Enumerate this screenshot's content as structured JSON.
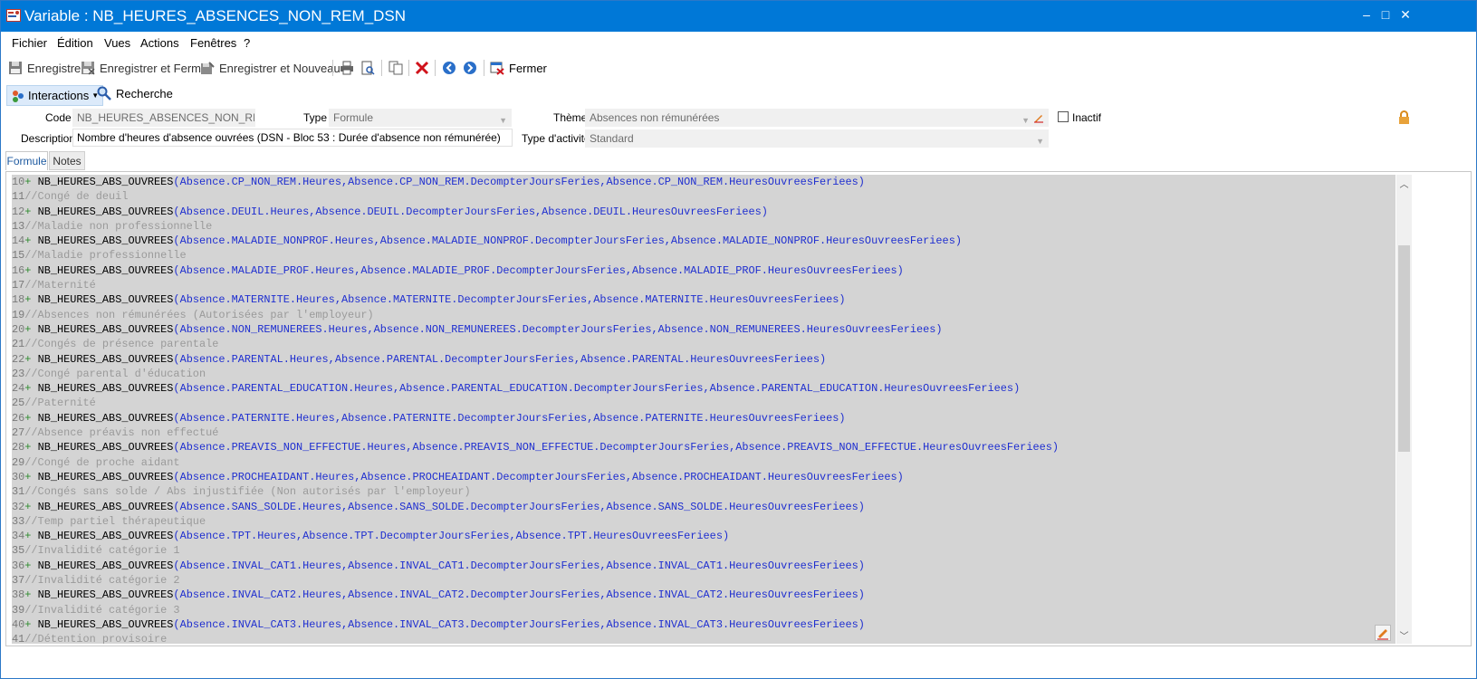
{
  "window": {
    "title": "Variable : NB_HEURES_ABSENCES_NON_REM_DSN",
    "minimize": "–",
    "maximize": "□",
    "close": "✕"
  },
  "menu": [
    "Fichier",
    "Édition",
    "Vues",
    "Actions",
    "Fenêtres",
    "?"
  ],
  "toolbar": {
    "save": "Enregistrer",
    "save_close": "Enregistrer et Fermer",
    "save_new": "Enregistrer et Nouveau",
    "close": "Fermer"
  },
  "toolbar2": {
    "interactions": "Interactions",
    "search": "Recherche"
  },
  "form": {
    "code_label": "Code",
    "code_value": "NB_HEURES_ABSENCES_NON_REM_DSN",
    "type_label": "Type",
    "type_value": "Formule",
    "theme_label": "Thème",
    "theme_value": "Absences non rémunérées",
    "inactive_label": "Inactif",
    "description_label": "Description",
    "description_value": "Nombre d'heures d'absence ouvrées (DSN - Bloc 53 : Durée d'absence non rémunérée)",
    "activity_label": "Type d'activité",
    "activity_value": "Standard"
  },
  "tabs": [
    "Formule",
    "Notes"
  ],
  "code_lines": [
    {
      "n": "10",
      "kind": "call",
      "fn": "NB_HEURES_ABS_OUVREES",
      "args": "Absence.CP_NON_REM.Heures,Absence.CP_NON_REM.DecompterJoursFeries,Absence.CP_NON_REM.HeuresOuvreesFeriees"
    },
    {
      "n": "11",
      "kind": "comment",
      "text": "//Congé de deuil"
    },
    {
      "n": "12",
      "kind": "call",
      "fn": "NB_HEURES_ABS_OUVREES",
      "args": "Absence.DEUIL.Heures,Absence.DEUIL.DecompterJoursFeries,Absence.DEUIL.HeuresOuvreesFeriees"
    },
    {
      "n": "13",
      "kind": "comment",
      "text": "//Maladie non professionnelle"
    },
    {
      "n": "14",
      "kind": "call",
      "fn": "NB_HEURES_ABS_OUVREES",
      "args": "Absence.MALADIE_NONPROF.Heures,Absence.MALADIE_NONPROF.DecompterJoursFeries,Absence.MALADIE_NONPROF.HeuresOuvreesFeriees"
    },
    {
      "n": "15",
      "kind": "comment",
      "text": "//Maladie professionnelle"
    },
    {
      "n": "16",
      "kind": "call",
      "fn": "NB_HEURES_ABS_OUVREES",
      "args": "Absence.MALADIE_PROF.Heures,Absence.MALADIE_PROF.DecompterJoursFeries,Absence.MALADIE_PROF.HeuresOuvreesFeriees"
    },
    {
      "n": "17",
      "kind": "comment",
      "text": "//Maternité"
    },
    {
      "n": "18",
      "kind": "call",
      "fn": "NB_HEURES_ABS_OUVREES",
      "args": "Absence.MATERNITE.Heures,Absence.MATERNITE.DecompterJoursFeries,Absence.MATERNITE.HeuresOuvreesFeriees"
    },
    {
      "n": "19",
      "kind": "comment",
      "text": "//Absences non rémunérées (Autorisées par l'employeur)"
    },
    {
      "n": "20",
      "kind": "call",
      "fn": "NB_HEURES_ABS_OUVREES",
      "args": "Absence.NON_REMUNEREES.Heures,Absence.NON_REMUNEREES.DecompterJoursFeries,Absence.NON_REMUNEREES.HeuresOuvreesFeriees"
    },
    {
      "n": "21",
      "kind": "comment",
      "text": "//Congés de présence parentale"
    },
    {
      "n": "22",
      "kind": "call",
      "fn": "NB_HEURES_ABS_OUVREES",
      "args": "Absence.PARENTAL.Heures,Absence.PARENTAL.DecompterJoursFeries,Absence.PARENTAL.HeuresOuvreesFeriees"
    },
    {
      "n": "23",
      "kind": "comment",
      "text": "//Congé parental d'éducation"
    },
    {
      "n": "24",
      "kind": "call",
      "fn": "NB_HEURES_ABS_OUVREES",
      "args": "Absence.PARENTAL_EDUCATION.Heures,Absence.PARENTAL_EDUCATION.DecompterJoursFeries,Absence.PARENTAL_EDUCATION.HeuresOuvreesFeriees"
    },
    {
      "n": "25",
      "kind": "comment",
      "text": "//Paternité"
    },
    {
      "n": "26",
      "kind": "call",
      "fn": "NB_HEURES_ABS_OUVREES",
      "args": "Absence.PATERNITE.Heures,Absence.PATERNITE.DecompterJoursFeries,Absence.PATERNITE.HeuresOuvreesFeriees"
    },
    {
      "n": "27",
      "kind": "comment",
      "text": "//Absence préavis non effectué"
    },
    {
      "n": "28",
      "kind": "call",
      "fn": "NB_HEURES_ABS_OUVREES",
      "args": "Absence.PREAVIS_NON_EFFECTUE.Heures,Absence.PREAVIS_NON_EFFECTUE.DecompterJoursFeries,Absence.PREAVIS_NON_EFFECTUE.HeuresOuvreesFeriees"
    },
    {
      "n": "29",
      "kind": "comment",
      "text": "//Congé de proche aidant"
    },
    {
      "n": "30",
      "kind": "call",
      "fn": "NB_HEURES_ABS_OUVREES",
      "args": "Absence.PROCHEAIDANT.Heures,Absence.PROCHEAIDANT.DecompterJoursFeries,Absence.PROCHEAIDANT.HeuresOuvreesFeriees"
    },
    {
      "n": "31",
      "kind": "comment",
      "text": "//Congés sans solde / Abs injustifiée (Non autorisés par l'employeur)"
    },
    {
      "n": "32",
      "kind": "call",
      "fn": "NB_HEURES_ABS_OUVREES",
      "args": "Absence.SANS_SOLDE.Heures,Absence.SANS_SOLDE.DecompterJoursFeries,Absence.SANS_SOLDE.HeuresOuvreesFeriees"
    },
    {
      "n": "33",
      "kind": "comment",
      "text": "//Temp partiel thérapeutique"
    },
    {
      "n": "34",
      "kind": "call",
      "fn": "NB_HEURES_ABS_OUVREES",
      "args": "Absence.TPT.Heures,Absence.TPT.DecompterJoursFeries,Absence.TPT.HeuresOuvreesFeriees"
    },
    {
      "n": "35",
      "kind": "comment",
      "text": "//Invalidité catégorie 1"
    },
    {
      "n": "36",
      "kind": "call",
      "fn": "NB_HEURES_ABS_OUVREES",
      "args": "Absence.INVAL_CAT1.Heures,Absence.INVAL_CAT1.DecompterJoursFeries,Absence.INVAL_CAT1.HeuresOuvreesFeriees"
    },
    {
      "n": "37",
      "kind": "comment",
      "text": "//Invalidité catégorie 2"
    },
    {
      "n": "38",
      "kind": "call",
      "fn": "NB_HEURES_ABS_OUVREES",
      "args": "Absence.INVAL_CAT2.Heures,Absence.INVAL_CAT2.DecompterJoursFeries,Absence.INVAL_CAT2.HeuresOuvreesFeriees"
    },
    {
      "n": "39",
      "kind": "comment",
      "text": "//Invalidité catégorie 3"
    },
    {
      "n": "40",
      "kind": "call",
      "fn": "NB_HEURES_ABS_OUVREES",
      "args": "Absence.INVAL_CAT3.Heures,Absence.INVAL_CAT3.DecompterJoursFeries,Absence.INVAL_CAT3.HeuresOuvreesFeriees"
    },
    {
      "n": "41",
      "kind": "comment",
      "text": "//Détention provisoire"
    }
  ],
  "colors": {
    "titlebar": "#0078d7",
    "code_function": "#000000",
    "code_args": "#1f2fd0",
    "code_comment": "#9a9a9a",
    "code_plus": "#2e8b2e",
    "editor_bg": "#d4d4d4"
  }
}
